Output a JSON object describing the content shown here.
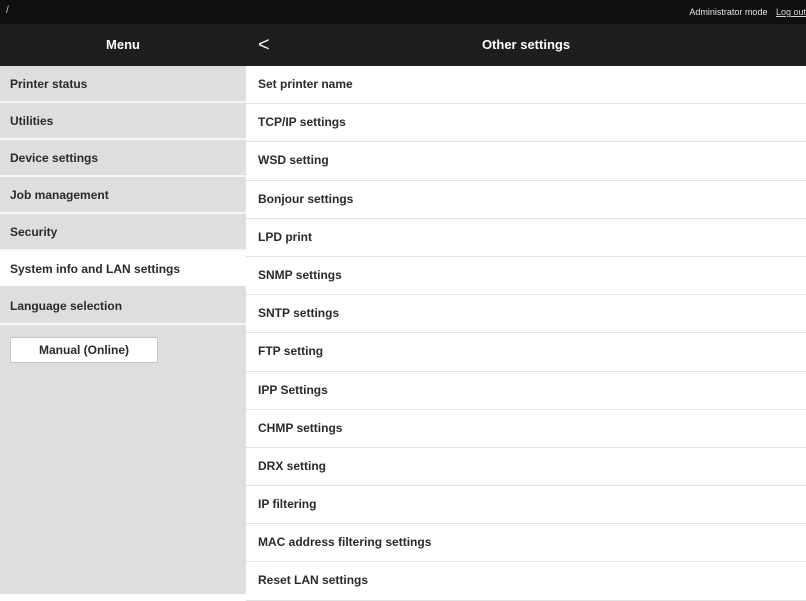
{
  "topbar": {
    "left_mark": "/",
    "mode": "Administrator mode",
    "logout": "Log out"
  },
  "header": {
    "menu_title": "Menu",
    "back_glyph": "<",
    "page_title": "Other settings"
  },
  "sidebar": {
    "items": [
      {
        "label": "Printer status"
      },
      {
        "label": "Utilities"
      },
      {
        "label": "Device settings"
      },
      {
        "label": "Job management"
      },
      {
        "label": "Security"
      },
      {
        "label": "System info and LAN settings"
      },
      {
        "label": "Language selection"
      }
    ],
    "manual_button": "Manual (Online)"
  },
  "main": {
    "items": [
      {
        "label": "Set printer name"
      },
      {
        "label": "TCP/IP settings"
      },
      {
        "label": "WSD setting"
      },
      {
        "label": "Bonjour settings"
      },
      {
        "label": "LPD print"
      },
      {
        "label": "SNMP settings"
      },
      {
        "label": "SNTP settings"
      },
      {
        "label": "FTP setting"
      },
      {
        "label": "IPP Settings"
      },
      {
        "label": "CHMP settings"
      },
      {
        "label": "DRX setting"
      },
      {
        "label": "IP filtering"
      },
      {
        "label": "MAC address filtering settings"
      },
      {
        "label": "Reset LAN settings"
      }
    ]
  }
}
